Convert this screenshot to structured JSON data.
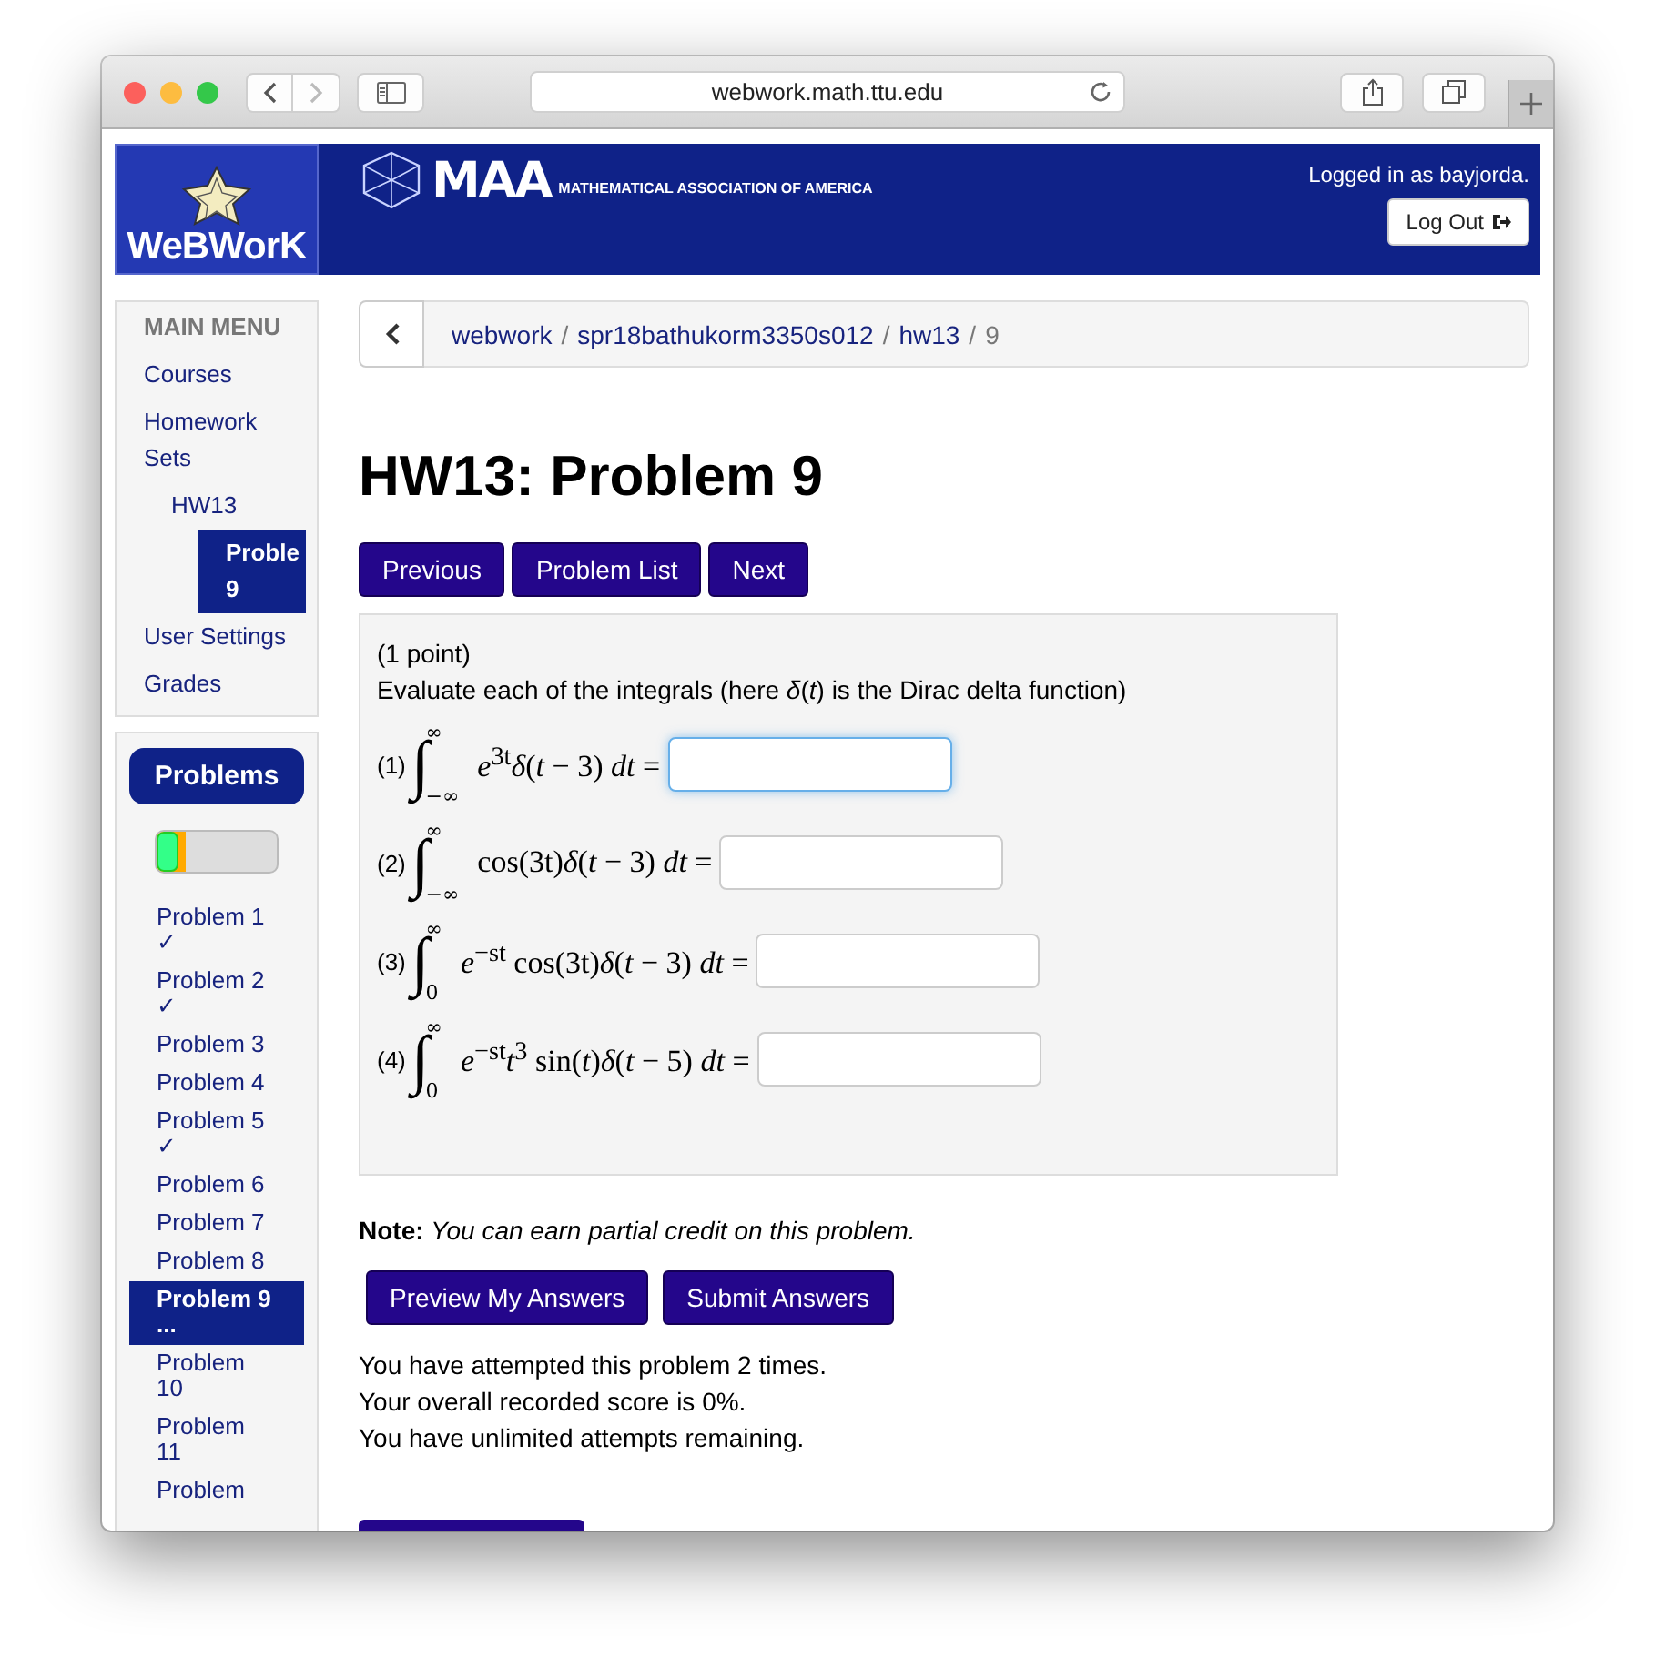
{
  "browser": {
    "url": "webwork.math.ttu.edu"
  },
  "header": {
    "logo_text": "WeBWorK",
    "org_short": "MAA",
    "org_name": "MATHEMATICAL ASSOCIATION OF AMERICA",
    "user_text": "Logged in as bayjorda.",
    "logout_button": "Log Out"
  },
  "main_menu": {
    "title": "MAIN MENU",
    "items": [
      {
        "label": "Courses",
        "selected": false
      },
      {
        "label": "Homework Sets",
        "selected": false,
        "children": [
          {
            "label": "HW13",
            "selected": false,
            "children": [
              {
                "label": "Proble\n9",
                "selected": true
              }
            ]
          }
        ]
      },
      {
        "label": "User Settings",
        "selected": false
      },
      {
        "label": "Grades",
        "selected": false
      }
    ]
  },
  "problems_panel": {
    "title": "Problems",
    "progress": [
      {
        "kind": "correct",
        "level": 0.18,
        "color": "#33ff88"
      },
      {
        "kind": "partial",
        "level": 0.24,
        "color": "#ffaa00"
      }
    ],
    "items": [
      {
        "label": "Problem 1",
        "mark": "✓",
        "selected": false
      },
      {
        "label": "Problem 2",
        "mark": "✓",
        "selected": false
      },
      {
        "label": "Problem 3",
        "selected": false
      },
      {
        "label": "Problem 4",
        "selected": false
      },
      {
        "label": "Problem 5",
        "mark": "✓",
        "selected": false
      },
      {
        "label": "Problem 6",
        "selected": false
      },
      {
        "label": "Problem 7",
        "selected": false
      },
      {
        "label": "Problem 8",
        "selected": false
      },
      {
        "label": "Problem 9",
        "mark": "...",
        "selected": true
      },
      {
        "label": "Problem 10",
        "selected": false
      },
      {
        "label": "Problem 11",
        "selected": false
      },
      {
        "label": "Problem",
        "selected": false
      }
    ]
  },
  "breadcrumb": [
    {
      "label": "webwork",
      "kind": "link"
    },
    {
      "label": "/",
      "kind": "separator"
    },
    {
      "label": "spr18bathukorm3350s012",
      "kind": "link"
    },
    {
      "label": "/",
      "kind": "separator"
    },
    {
      "label": "hw13",
      "kind": "link"
    },
    {
      "label": "/",
      "kind": "separator"
    },
    {
      "label": "9",
      "kind": "current"
    }
  ],
  "title": "HW13: Problem 9",
  "nav_buttons": [
    "Previous",
    "Problem List",
    "Next"
  ],
  "problem": {
    "points": "(1 point)",
    "intro": "Evaluate each of the integrals (here *δ*(*t*) is the Dirac delta function)",
    "parts": [
      {
        "number": "(1)",
        "integral": "∫",
        "upper": "∞",
        "lower": "−∞",
        "integrand": "*e*$^{3t}$*δ*(*t* − 3) *dt* =",
        "focused": true
      },
      {
        "number": "(2)",
        "integral": "∫",
        "upper": "∞",
        "lower": "−∞",
        "integrand": "cos(3t)*δ*(*t* − 3) *dt* =",
        "focused": false
      },
      {
        "number": "(3)",
        "integral": "∫",
        "upper": "∞",
        "lower": "0",
        "integrand": "*e*$^{−st}$ cos(3t)*δ*(*t* − 3) *dt* =",
        "focused": false
      },
      {
        "number": "(4)",
        "integral": "∫",
        "upper": "∞",
        "lower": "0",
        "integrand": "*e*$^{−st}$*t*$^{3}$ sin(*t*)*δ*(*t* − 5) *dt* =",
        "focused": false
      }
    ]
  },
  "note": "**Note:** *You can earn partial credit on this problem.*",
  "submit_buttons": [
    "Preview My Answers",
    "Submit Answers"
  ],
  "status_lines": [
    "You have attempted this problem 2 times.",
    "Your overall recorded score is 0%.",
    "You have unlimited attempts remaining."
  ]
}
